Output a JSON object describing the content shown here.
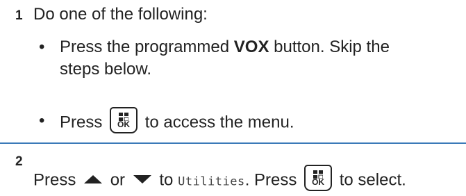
{
  "steps": [
    {
      "number": "1",
      "intro": "Do one of the following:",
      "bullets": [
        {
          "marker": "•",
          "pre": "Press the programmed ",
          "bold": "VOX",
          "post": " button. Skip the",
          "line2": "steps below."
        },
        {
          "marker": "•",
          "pre": "Press",
          "post": "to access the menu."
        }
      ]
    },
    {
      "number": "2",
      "pre": "Press",
      "or": "or",
      "to": "to",
      "menu_item": "Utilities",
      "press": ". Press",
      "post": "to select."
    }
  ],
  "ok_button": {
    "label": "OK",
    "icon": "menu-ok-key-icon"
  },
  "icons": {
    "up": "up-arrow-icon",
    "down": "down-arrow-icon"
  },
  "colors": {
    "divider": "#3b7ab8",
    "text": "#222222"
  }
}
